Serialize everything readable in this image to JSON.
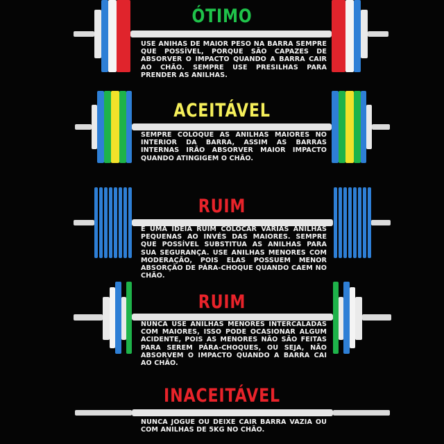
{
  "sections": [
    {
      "heading": "ÓTIMO",
      "heading_color": "#1fc24a",
      "text": "USE ANIHAS DE MAIOR PESO NA BARRA SEMPRE QUE POSSÍVEL, PORQUE SÃO CAPAZES DE ABSORVER O IMPACTO QUANDO A BARRA CAIR AO CHÃO. SEMPRE USE PRESILHAS PARA PRENDER AS ANILHAS."
    },
    {
      "heading": "ACEITÁVEL",
      "heading_color": "#f5ef5a",
      "text": "SEMPRE COLOQUE AS ANILHAS MAIORES NO INTERIOR DA BARRA, ASSIM AS BARRAS INTERNAS IRÃO ABSORVER MAIOR IMPACTO QUANDO ATINGIGEM O CHÃO."
    },
    {
      "heading": "RUIM",
      "heading_color": "#e8232a",
      "text": "É UMA IDEIA RUIM COLOCAR VÁRIAS ANILHAS PEQUENAS AO INVÉS DAS MAIORES. SEMPRE QUE POSSÍVEL SUBSTITUA AS ANILHAS PARA SUA SEGURANÇA. USE ANILHAS MENORES COM MODERAÇÃO, POIS ELAS POSSUEM MENOR ABSORÇÃO DE PÁRA-CHOQUE QUANDO CAEM NO CHÃO."
    },
    {
      "heading": "RUIM",
      "heading_color": "#e8232a",
      "text": "NUNCA USE ANILHAS MENORES INTERCALADAS COM MAIORES, ISSO PODE OCASIONAR ALGUM ACIDENTE, POIS AS MENORES NÃO SÃO FEITAS PARA SEREM PÁRA-CHOQUES, OU SEJA, NÃO ABSORVEM O IMPACTO QUANDO A BARRA CAI AO CHÃO."
    },
    {
      "heading": "INACEITÁVEL",
      "heading_color": "#e8232a",
      "text": "NUNCA JOGUE OU DEIXE CAIR BARRA VAZIA OU COM ANILHAS DE 5KG NO CHÃO."
    }
  ],
  "colors": {
    "background": "#050505",
    "bar": "#e6e6e6",
    "plate_red": "#e0242c",
    "plate_blue": "#2e7fd6",
    "plate_yellow": "#f2e22a",
    "plate_green": "#1eb34a",
    "plate_white": "#f0f0f0"
  }
}
